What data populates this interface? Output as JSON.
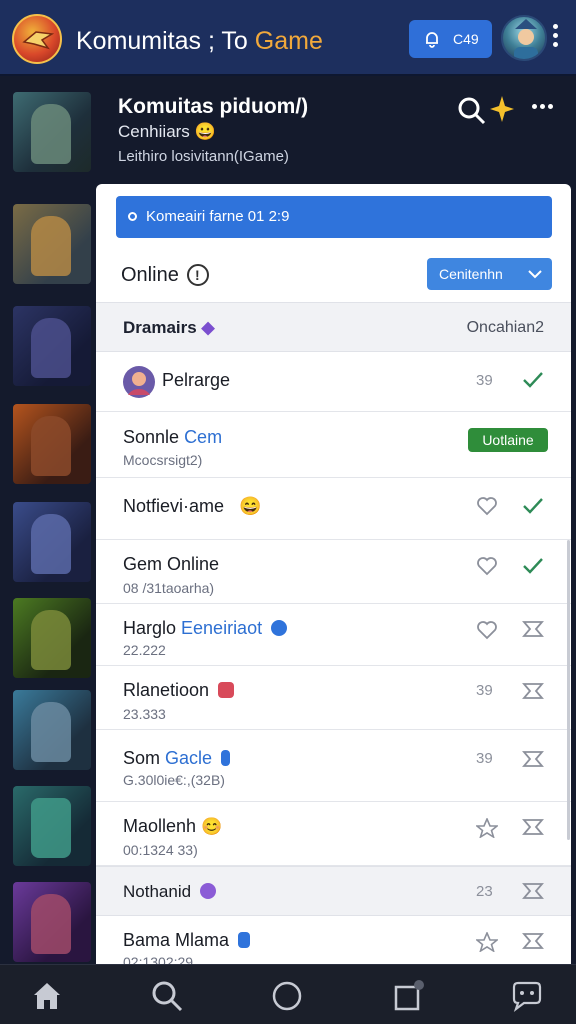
{
  "topbar": {
    "title_main": "Komumitas",
    "title_mid": " ; To ",
    "title_accent": "Game",
    "notif_count": "C49",
    "icons": [
      "logo-icon",
      "bell-icon",
      "avatar",
      "more-vertical-icon"
    ]
  },
  "header": {
    "title": "Komuitas piduom/)",
    "subtitle": "Cenhiiars 😀",
    "game": "Leithiro losivitann(IGame)",
    "icons": [
      "search-icon",
      "sparkle-icon",
      "more-horizontal-icon"
    ]
  },
  "panel": {
    "banner": "Komeairi farne 01 2:9",
    "online_label": "Online",
    "sort_label": "Cenitenhn",
    "section1": {
      "name": "Dramairs",
      "right": "Oncahian2"
    },
    "section2": {
      "name": "Nothanid",
      "count": "23"
    },
    "members": [
      {
        "name": "Pelrarge",
        "count": "39",
        "action": "check"
      },
      {
        "name_a": "Sonnle ",
        "name_b": "Cem",
        "sub": "Mcocsrsigt2)",
        "status": "Uotlaine"
      },
      {
        "name": "Notfievi·ame",
        "count": "",
        "action": "check"
      },
      {
        "name": "Gem Online",
        "sub": "08 /31taoarha)",
        "count": "",
        "action": "check"
      },
      {
        "name_a": "Harglo ",
        "name_b": "Eeneiriaot",
        "sub": "22.222",
        "count": "",
        "action": "flag"
      },
      {
        "name": "Rlanetioon",
        "sub": "23.333",
        "count": "39",
        "action": "flag"
      },
      {
        "name_a": "Som ",
        "name_b": "Gacle",
        "sub": "G.30l0ie€:,(32B)",
        "count": "39",
        "action": "flag"
      },
      {
        "name": "Maollenh",
        "sub": "00:1324 33)",
        "count": "",
        "action": "flag"
      },
      {
        "name": "Bama Mlama",
        "sub": "02:1302:29",
        "count": "",
        "action": "flag"
      }
    ]
  },
  "bottom_nav": [
    "home-icon",
    "search-icon",
    "circle-icon",
    "square-icon",
    "chat-icon"
  ],
  "colors": {
    "topbar": "#1d2f5e",
    "accent": "#f2a93b",
    "primary": "#2f73db",
    "success": "#2f8d3a"
  }
}
